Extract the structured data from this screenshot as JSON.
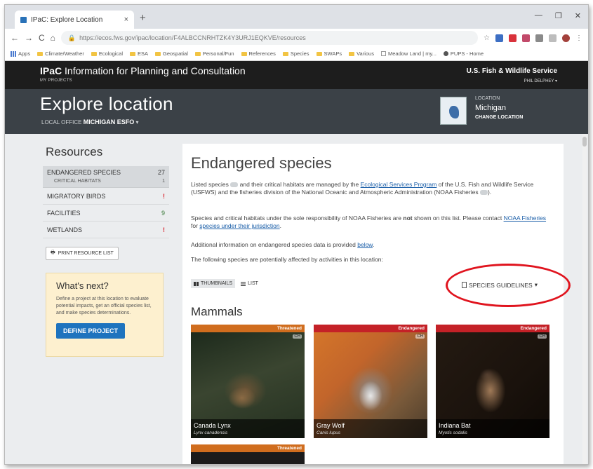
{
  "browser": {
    "tab_title": "IPaC: Explore Location",
    "url": "https://ecos.fws.gov/ipac/location/F4ALBCCNRHTZK4Y3URJ1EQKVE/resources",
    "bookmarks": [
      "Apps",
      "Climate/Weather",
      "Ecological",
      "ESA",
      "Geospatial",
      "Personal/Fun",
      "References",
      "Species",
      "SWAPs",
      "Various",
      "Meadow Land | my...",
      "PUPS - Home"
    ]
  },
  "header": {
    "brand_abbr": "IPaC",
    "brand_full": "Information for Planning and Consultation",
    "my_projects": "MY PROJECTS",
    "agency": "U.S. Fish & Wildlife Service",
    "user": "PHIL DELPHEY"
  },
  "hero": {
    "title": "Explore location",
    "office_label": "LOCAL OFFICE",
    "office_name": "MICHIGAN ESFO",
    "location_label": "LOCATION",
    "location_name": "Michigan",
    "change_location": "CHANGE LOCATION"
  },
  "sidebar": {
    "title": "Resources",
    "items": [
      {
        "label": "ENDANGERED SPECIES",
        "count": "27"
      },
      {
        "label": "CRITICAL HABITATS",
        "count": "1"
      },
      {
        "label": "MIGRATORY BIRDS",
        "count": "!"
      },
      {
        "label": "FACILITIES",
        "count": "9"
      },
      {
        "label": "WETLANDS",
        "count": "!"
      }
    ],
    "print_label": "PRINT RESOURCE LIST",
    "next_title": "What's next?",
    "next_text": "Define a project at this location to evaluate potential impacts, get an official species list, and make species determinations.",
    "define_label": "DEFINE PROJECT"
  },
  "main": {
    "title": "Endangered species",
    "p1_a": "Listed species",
    "p1_b": "and their critical habitats are managed by the",
    "p1_link": "Ecological Services Program",
    "p1_c": "of the U.S. Fish and Wildlife Service (USFWS) and the fisheries division of the National Oceanic and Atmospheric Administration (NOAA Fisheries",
    "p1_d": ").",
    "p2_a": "Species and critical habitats under the sole responsibility of NOAA Fisheries are",
    "p2_not": "not",
    "p2_b": "shown on this list. Please contact",
    "p2_link1": "NOAA Fisheries",
    "p2_c": "for",
    "p2_link2": "species under their jurisdiction",
    "p2_d": ".",
    "p3_a": "Additional information on endangered species data is provided",
    "p3_link": "below",
    "p3_b": ".",
    "p4": "The following species are potentially affected by activities in this location:",
    "view_thumbnails": "THUMBNAILS",
    "view_list": "LIST",
    "guidelines": "SPECIES GUIDELINES",
    "section": "Mammals",
    "cards": [
      {
        "status": "Threatened",
        "ch": "CH",
        "name": "Canada Lynx",
        "sci": "Lynx canadensis"
      },
      {
        "status": "Endangered",
        "ch": "CH",
        "name": "Gray Wolf",
        "sci": "Canis lupus"
      },
      {
        "status": "Endangered",
        "ch": "CH",
        "name": "Indiana Bat",
        "sci": "Myotis sodalis"
      },
      {
        "status": "Threatened"
      }
    ]
  },
  "colors": {
    "threatened": "#d06d1e",
    "endangered": "#c42127",
    "link": "#1a5ea8",
    "annotation": "#e0141e"
  }
}
